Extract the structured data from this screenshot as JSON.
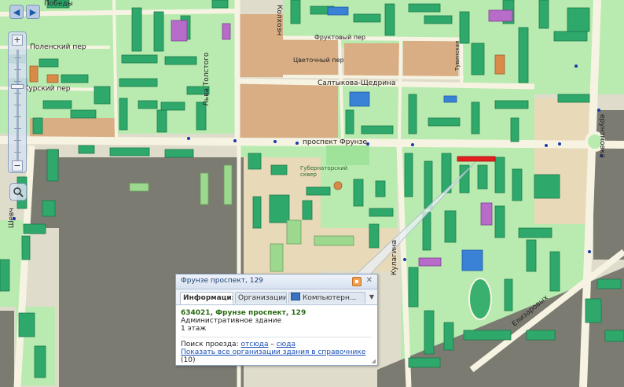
{
  "map": {
    "streets": [
      {
        "id": "pobedy",
        "text": "Победы"
      },
      {
        "id": "kolhoznaya",
        "text": "Колхозн"
      },
      {
        "id": "fruktoviy",
        "text": "Фруктовый пер"
      },
      {
        "id": "tsvetochniy",
        "text": "Цветочный пер"
      },
      {
        "id": "polenskiy",
        "text": "Поленский пер"
      },
      {
        "id": "kurskiy",
        "text": "Курский пер"
      },
      {
        "id": "lva-tolstogo",
        "text": "Льва Толстого"
      },
      {
        "id": "saltykova",
        "text": "Салтыкова-Щедрина"
      },
      {
        "id": "frunze",
        "text": "проспект Фрунзе"
      },
      {
        "id": "gubernatorskiy",
        "text": "Губернаторский сквер"
      },
      {
        "id": "kulagina",
        "text": "Кулагина"
      },
      {
        "id": "elizarovyh",
        "text": "Елизаровых"
      },
      {
        "id": "shevchenko",
        "text": "Шевч"
      },
      {
        "id": "tuvinskaya",
        "text": "Тувинская"
      },
      {
        "id": "erunsmovka",
        "text": "ерунзмовка"
      }
    ]
  },
  "nav": {
    "back_arrow": "◀",
    "forward_arrow": "▶"
  },
  "zoom": {
    "plus": "+",
    "minus": "−"
  },
  "popup": {
    "title": "Фрунзе проспект, 129",
    "tabs": [
      "Информация",
      "Организации",
      "Компьютерн..."
    ],
    "address": "634021, Фрунзе проспект, 129",
    "building_type": "Административное здание",
    "floors": "1 этаж",
    "route_label": "Поиск проезда:",
    "route_from": "отсюда",
    "route_dash": " – ",
    "route_to": "сюда",
    "orgs_link": "Показать все организации здания в справочнике",
    "orgs_count": "(10)"
  },
  "colors": {
    "park_green": "#b9ebb0",
    "road": "#f7f3e2",
    "industrial": "#7b7b72",
    "private_sector": "#d9ae84",
    "building_green": "#2fa86c",
    "building_blue": "#3a82d6",
    "building_purple": "#b66cc8",
    "building_orange": "#d98a48",
    "highlight_red": "#e41f1f"
  }
}
